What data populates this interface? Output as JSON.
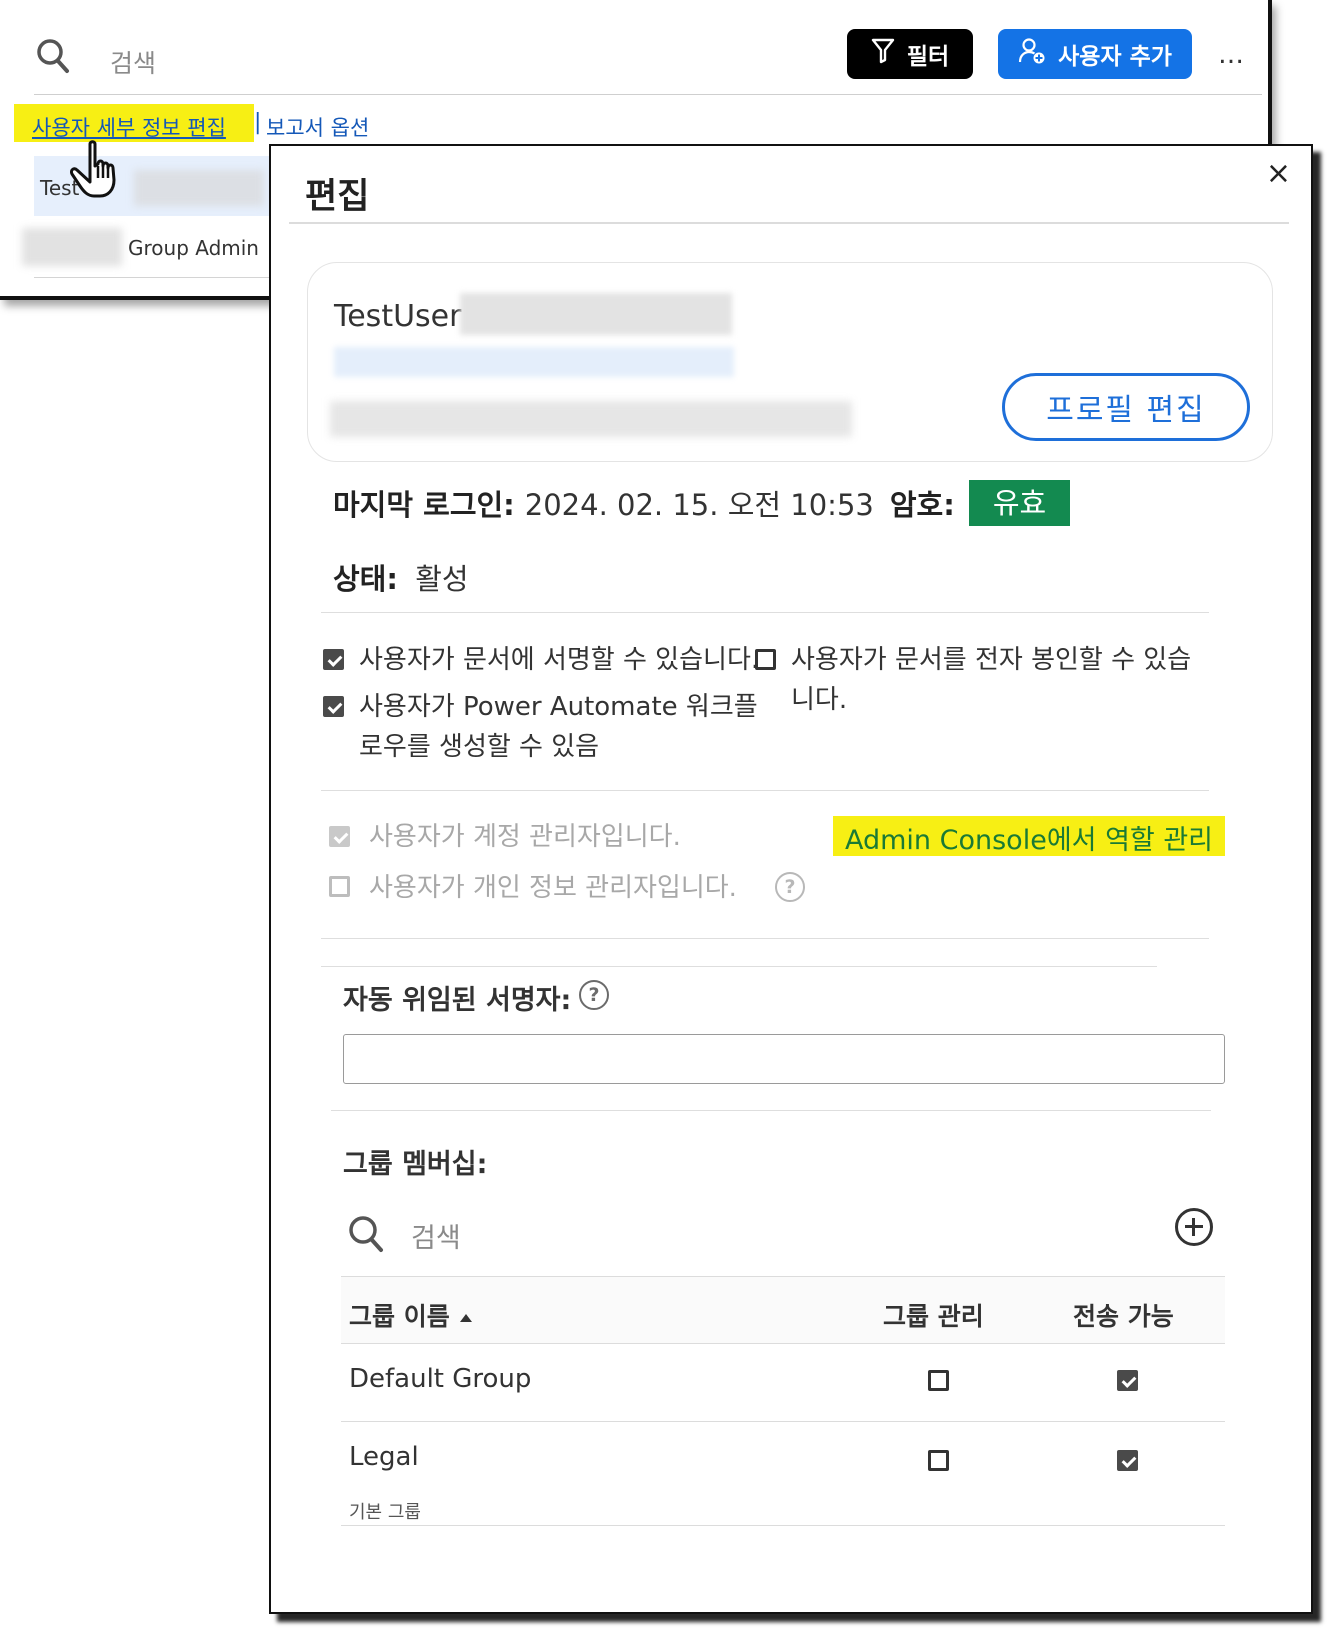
{
  "toolbar": {
    "search_placeholder": "검색",
    "filter_label": "필터",
    "add_user_label": "사용자 추가",
    "more_label": "…"
  },
  "links": {
    "edit_user_details": "사용자 세부 정보 편집",
    "separator": "|",
    "report_options": "보고서 옵션"
  },
  "user_list": {
    "row1_name": "Test",
    "row2_role": "Group Admin"
  },
  "modal": {
    "title": "편집",
    "close_label": "×",
    "profile": {
      "name": "TestUser",
      "edit_profile_label": "프로필 편집"
    },
    "last_login_label": "마지막 로그인:",
    "last_login_value": "2024. 02. 15. 오전 10:53",
    "password_label": "암호:",
    "password_status": "유효",
    "status_label": "상태:",
    "status_value": "활성",
    "permissions": {
      "can_sign": "사용자가 문서에 서명할 수 있습니다.",
      "can_create_power_automate_line1": "사용자가 Power Automate 워크플",
      "can_create_power_automate_line2": "로우를 생성할 수 있음",
      "can_e_seal_line1": "사용자가 문서를 전자 봉인할 수 있습",
      "can_e_seal_line2": "니다.",
      "is_account_admin": "사용자가 계정 관리자입니다.",
      "is_privacy_admin": "사용자가 개인 정보 관리자입니다.",
      "admin_console_link": "Admin Console에서 역할 관리"
    },
    "auto_delegate_label": "자동 위임된 서명자:",
    "group_membership": {
      "title": "그룹 멤버십:",
      "search_placeholder": "검색",
      "columns": [
        "그룹 이름",
        "그룹 관리",
        "전송 가능"
      ],
      "rows": [
        {
          "name": "Default Group",
          "sub": "",
          "group_admin": false,
          "can_send": true
        },
        {
          "name": "Legal",
          "sub": "기본 그룹",
          "group_admin": false,
          "can_send": true
        }
      ]
    },
    "help_glyph": "?"
  },
  "colors": {
    "accent_blue": "#1473e6",
    "link_blue": "#1458b8",
    "valid_green": "#138a50",
    "highlight_yellow": "#f7ef14"
  }
}
